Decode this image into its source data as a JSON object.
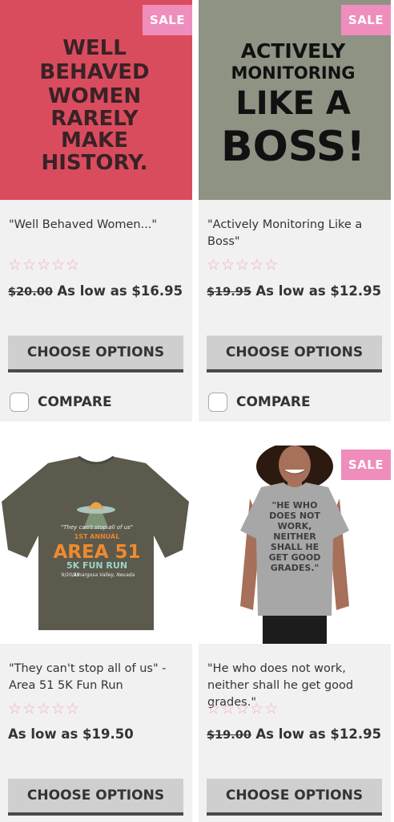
{
  "colors": {
    "sale_badge": "#ef8dbd",
    "card_bg": "#f1f1f1",
    "button_bg": "#cfcfcf",
    "button_border": "#4a4a4a",
    "star": "#f2a9c8"
  },
  "products": [
    {
      "sale_badge": "SALE",
      "image_text": [
        "WELL",
        "BEHAVED",
        "WOMEN",
        "RARELY",
        "MAKE",
        "HISTORY."
      ],
      "title": "\"Well Behaved Women...\"",
      "rating_stars": 0,
      "old_price": "$20.00",
      "price": "As low as $16.95",
      "button": "CHOOSE OPTIONS",
      "compare": "COMPARE"
    },
    {
      "sale_badge": "SALE",
      "image_text": [
        "ACTIVELY",
        "MONITORING",
        "LIKE A",
        "BOSS!"
      ],
      "title": "\"Actively Monitoring Like a Boss\"",
      "rating_stars": 0,
      "old_price": "$19.95",
      "price": "As low as $12.95",
      "button": "CHOOSE OPTIONS",
      "compare": "COMPARE"
    },
    {
      "image_text": [
        "\"They can't stop all of us\"",
        "1ST ANNUAL",
        "AREA 51",
        "5K FUN RUN",
        "9/20/19",
        "Amargosa Valley, Nevada"
      ],
      "title": "\"They can't stop all of us\" - Area 51 5K Fun Run",
      "rating_stars": 0,
      "price": "As low as $19.50",
      "button": "CHOOSE OPTIONS"
    },
    {
      "sale_badge": "SALE",
      "image_text": [
        "\"HE WHO",
        "DOES NOT",
        "WORK,",
        "NEITHER",
        "SHALL HE",
        "GET GOOD",
        "GRADES.\""
      ],
      "title": "\"He who does not work, neither shall he get good grades.\"",
      "rating_stars": 0,
      "old_price": "$19.00",
      "price": "As low as $12.95",
      "button": "CHOOSE OPTIONS"
    }
  ]
}
